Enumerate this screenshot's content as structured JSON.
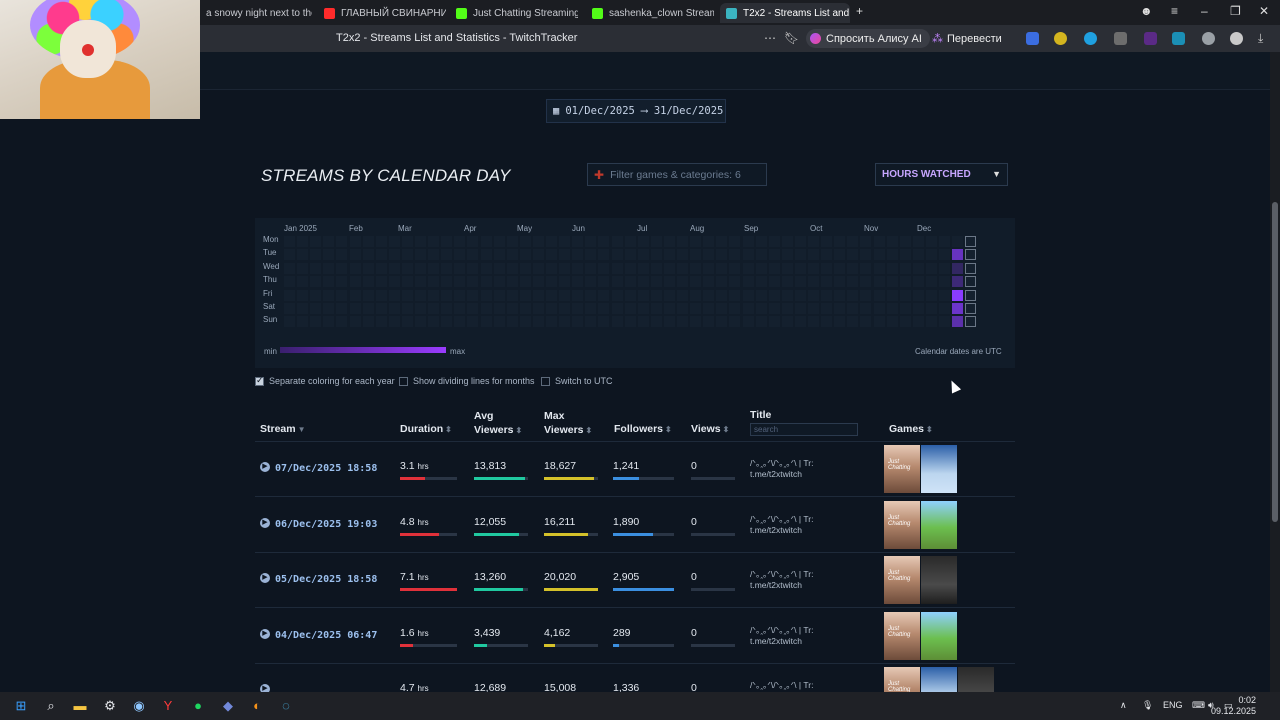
{
  "browser": {
    "tabs": [
      {
        "label": "a snowy night next to the f",
        "icon_color": "#3aa0ff"
      },
      {
        "label": "ГЛАВНЫЙ СВИНАРНИК",
        "icon_color": "#ff2b2b"
      },
      {
        "label": "Just Chatting Streaming -",
        "icon_color": "#53fc18"
      },
      {
        "label": "sashenka_clown Stream -",
        "icon_color": "#53fc18"
      },
      {
        "label": "T2x2 - Streams List and",
        "icon_color": "#3bb4c1",
        "active": true
      }
    ],
    "new_tab": "+",
    "page_title": "T2x2 - Streams List and Statistics - TwitchTracker",
    "alisa_label": "Спросить Алису AI",
    "translate_label": "Перевести"
  },
  "page": {
    "date_range": "01/Dec/2025 ⟶ 31/Dec/2025",
    "section_title": "STREAMS BY CALENDAR DAY",
    "filter_placeholder": "Filter games & categories: 6",
    "metric_select": "HOURS WATCHED",
    "heatmap": {
      "months": [
        "Jan 2025",
        "Feb",
        "Mar",
        "Apr",
        "May",
        "Jun",
        "Jul",
        "Aug",
        "Sep",
        "Oct",
        "Nov",
        "Dec"
      ],
      "days": [
        "Mon",
        "Tue",
        "Wed",
        "Thu",
        "Fri",
        "Sat",
        "Sun"
      ],
      "legend_min": "min",
      "legend_max": "max",
      "utc_note": "Calendar dates are UTC",
      "active_color": "#8a3cff"
    },
    "options": [
      {
        "label": "Separate coloring for each year",
        "checked": true
      },
      {
        "label": "Show dividing lines for months",
        "checked": false
      },
      {
        "label": "Switch to UTC",
        "checked": false
      }
    ]
  },
  "table": {
    "headers": {
      "stream": "Stream",
      "duration": "Duration",
      "avg_viewers_1": "Avg",
      "avg_viewers_2": "Viewers",
      "max_viewers_1": "Max",
      "max_viewers_2": "Viewers",
      "followers": "Followers",
      "views": "Views",
      "title": "Title",
      "games": "Games"
    },
    "title_search_placeholder": "search",
    "rows": [
      {
        "date": "07/Dec/2025 18:58",
        "duration": "3.1",
        "unit": "hrs",
        "avg": "13,813",
        "max": "18,627",
        "followers": "1,241",
        "views": "0",
        "title_1": "/ᐠ｡ꞈ｡ᐟ\\/ᐠ｡ꞈ｡ᐟ\\ | Tr:",
        "title_2": "t.me/t2xtwitch"
      },
      {
        "date": "06/Dec/2025 19:03",
        "duration": "4.8",
        "unit": "hrs",
        "avg": "12,055",
        "max": "16,211",
        "followers": "1,890",
        "views": "0",
        "title_1": "/ᐠ｡ꞈ｡ᐟ\\/ᐠ｡ꞈ｡ᐟ\\ | Tr:",
        "title_2": "t.me/t2xtwitch"
      },
      {
        "date": "05/Dec/2025 18:58",
        "duration": "7.1",
        "unit": "hrs",
        "avg": "13,260",
        "max": "20,020",
        "followers": "2,905",
        "views": "0",
        "title_1": "/ᐠ｡ꞈ｡ᐟ\\/ᐠ｡ꞈ｡ᐟ\\ | Tr:",
        "title_2": "t.me/t2xtwitch"
      },
      {
        "date": "04/Dec/2025 06:47",
        "duration": "1.6",
        "unit": "hrs",
        "avg": "3,439",
        "max": "4,162",
        "followers": "289",
        "views": "0",
        "title_1": "/ᐠ｡ꞈ｡ᐟ\\/ᐠ｡ꞈ｡ᐟ\\ | Tr:",
        "title_2": "t.me/t2xtwitch"
      },
      {
        "date": "",
        "duration": "4.7",
        "unit": "hrs",
        "avg": "12,689",
        "max": "15,008",
        "followers": "1,336",
        "views": "0",
        "title_1": "/ᐠ｡ꞈ｡ᐟ\\/ᐠ｡ꞈ｡ᐟ\\ | Tr:",
        "title_2": ""
      }
    ],
    "bar_colors": {
      "duration": "#e0313a",
      "avg": "#20c9a0",
      "max": "#d4c12a",
      "followers": "#3b8fe0"
    },
    "bar_levels": [
      {
        "duration": 0.44,
        "avg": 0.95,
        "max": 0.93,
        "followers": 0.43
      },
      {
        "duration": 0.68,
        "avg": 0.83,
        "max": 0.81,
        "followers": 0.65
      },
      {
        "duration": 1.0,
        "avg": 0.91,
        "max": 1.0,
        "followers": 1.0
      },
      {
        "duration": 0.23,
        "avg": 0.24,
        "max": 0.21,
        "followers": 0.1
      },
      {
        "duration": 0.66,
        "avg": 0.87,
        "max": 0.75,
        "followers": 0.46
      }
    ]
  },
  "taskbar": {
    "lang": "ENG",
    "time": "0:02",
    "date": "09.12.2025"
  }
}
